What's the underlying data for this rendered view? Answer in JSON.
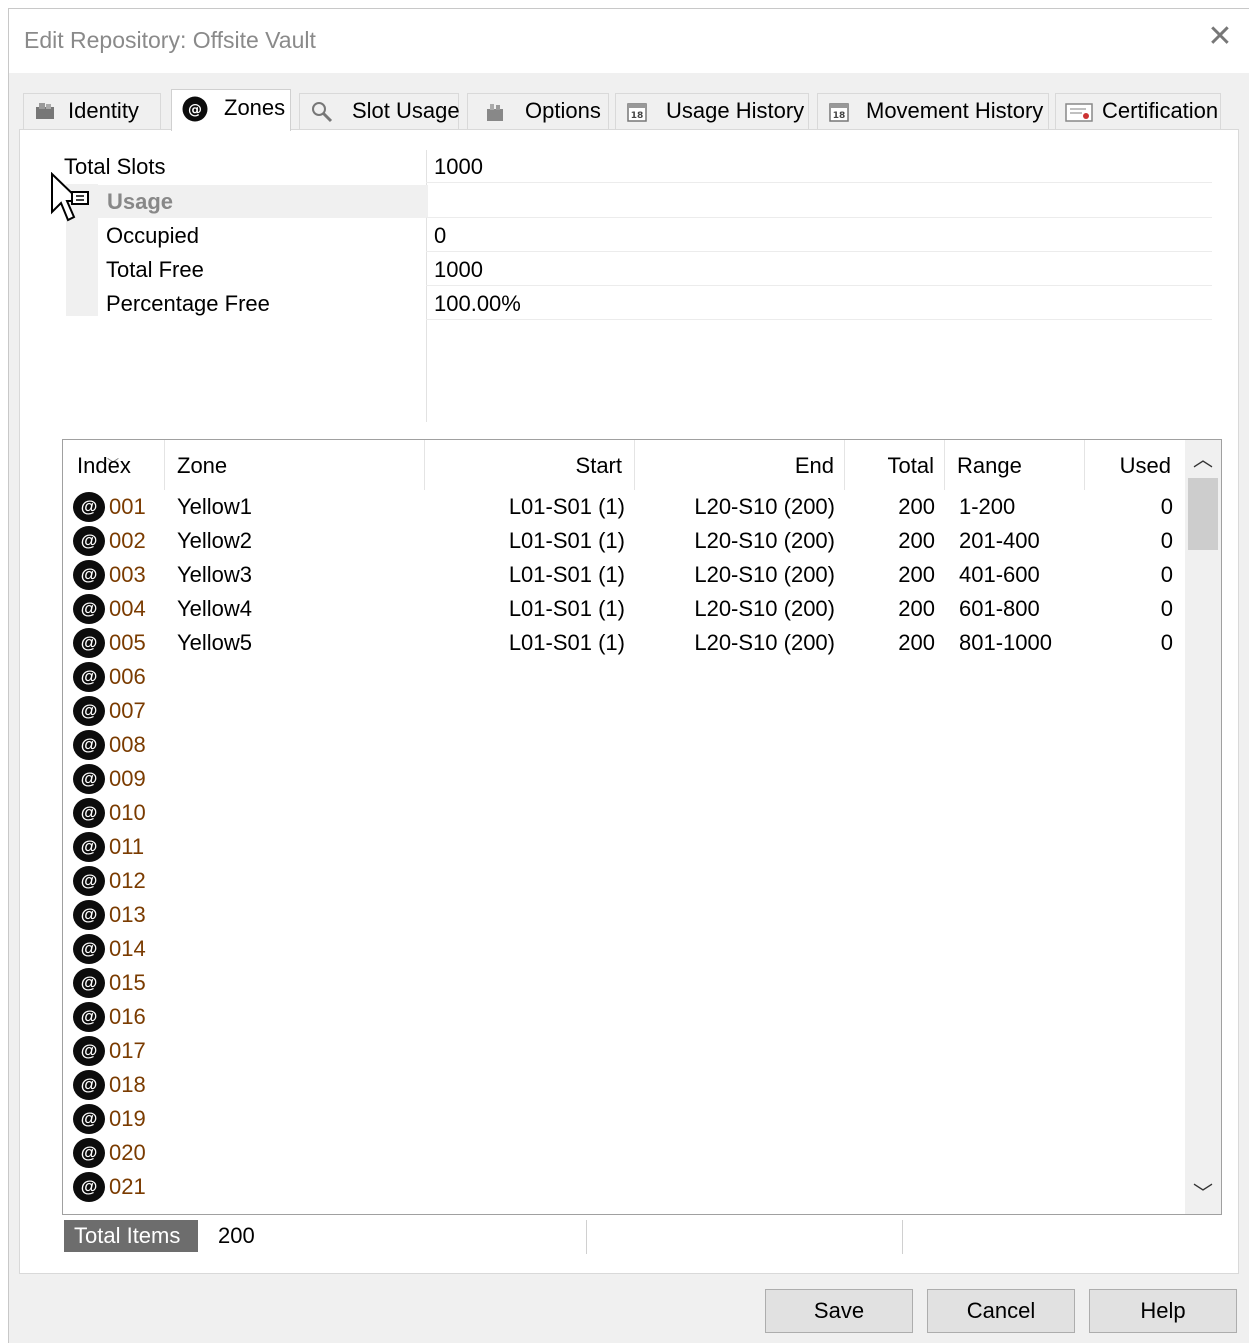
{
  "window": {
    "title": "Edit Repository: Offsite Vault"
  },
  "tabs": [
    {
      "label": "Identity",
      "icon": "identity-icon"
    },
    {
      "label": "Zones",
      "icon": "zones-icon"
    },
    {
      "label": "Slot Usage",
      "icon": "magnifier-icon"
    },
    {
      "label": "Options",
      "icon": "options-icon"
    },
    {
      "label": "Usage History",
      "icon": "calendar-icon"
    },
    {
      "label": "Movement History",
      "icon": "calendar-icon"
    },
    {
      "label": "Certification",
      "icon": "certificate-icon"
    }
  ],
  "active_tab": "Zones",
  "properties": {
    "total_slots": {
      "label": "Total Slots",
      "value": "1000"
    },
    "usage_header": "Usage",
    "occupied": {
      "label": "Occupied",
      "value": "0"
    },
    "total_free": {
      "label": "Total Free",
      "value": "1000"
    },
    "percentage_free": {
      "label": "Percentage Free",
      "value": "100.00%"
    }
  },
  "zones_table": {
    "columns": [
      "Index",
      "Zone",
      "Start",
      "End",
      "Total",
      "Range",
      "Used"
    ],
    "rows": [
      {
        "index": "001",
        "zone": "Yellow1",
        "start": "L01-S01 (1)",
        "end": "L20-S10 (200)",
        "total": "200",
        "range": "1-200",
        "used": "0"
      },
      {
        "index": "002",
        "zone": "Yellow2",
        "start": "L01-S01 (1)",
        "end": "L20-S10 (200)",
        "total": "200",
        "range": "201-400",
        "used": "0"
      },
      {
        "index": "003",
        "zone": "Yellow3",
        "start": "L01-S01 (1)",
        "end": "L20-S10 (200)",
        "total": "200",
        "range": "401-600",
        "used": "0"
      },
      {
        "index": "004",
        "zone": "Yellow4",
        "start": "L01-S01 (1)",
        "end": "L20-S10 (200)",
        "total": "200",
        "range": "601-800",
        "used": "0"
      },
      {
        "index": "005",
        "zone": "Yellow5",
        "start": "L01-S01 (1)",
        "end": "L20-S10 (200)",
        "total": "200",
        "range": "801-1000",
        "used": "0"
      },
      {
        "index": "006",
        "zone": "",
        "start": "",
        "end": "",
        "total": "",
        "range": "",
        "used": ""
      },
      {
        "index": "007",
        "zone": "",
        "start": "",
        "end": "",
        "total": "",
        "range": "",
        "used": ""
      },
      {
        "index": "008",
        "zone": "",
        "start": "",
        "end": "",
        "total": "",
        "range": "",
        "used": ""
      },
      {
        "index": "009",
        "zone": "",
        "start": "",
        "end": "",
        "total": "",
        "range": "",
        "used": ""
      },
      {
        "index": "010",
        "zone": "",
        "start": "",
        "end": "",
        "total": "",
        "range": "",
        "used": ""
      },
      {
        "index": "011",
        "zone": "",
        "start": "",
        "end": "",
        "total": "",
        "range": "",
        "used": ""
      },
      {
        "index": "012",
        "zone": "",
        "start": "",
        "end": "",
        "total": "",
        "range": "",
        "used": ""
      },
      {
        "index": "013",
        "zone": "",
        "start": "",
        "end": "",
        "total": "",
        "range": "",
        "used": ""
      },
      {
        "index": "014",
        "zone": "",
        "start": "",
        "end": "",
        "total": "",
        "range": "",
        "used": ""
      },
      {
        "index": "015",
        "zone": "",
        "start": "",
        "end": "",
        "total": "",
        "range": "",
        "used": ""
      },
      {
        "index": "016",
        "zone": "",
        "start": "",
        "end": "",
        "total": "",
        "range": "",
        "used": ""
      },
      {
        "index": "017",
        "zone": "",
        "start": "",
        "end": "",
        "total": "",
        "range": "",
        "used": ""
      },
      {
        "index": "018",
        "zone": "",
        "start": "",
        "end": "",
        "total": "",
        "range": "",
        "used": ""
      },
      {
        "index": "019",
        "zone": "",
        "start": "",
        "end": "",
        "total": "",
        "range": "",
        "used": ""
      },
      {
        "index": "020",
        "zone": "",
        "start": "",
        "end": "",
        "total": "",
        "range": "",
        "used": ""
      },
      {
        "index": "021",
        "zone": "",
        "start": "",
        "end": "",
        "total": "",
        "range": "",
        "used": ""
      }
    ]
  },
  "status": {
    "label": "Total Items",
    "value": "200"
  },
  "buttons": {
    "save": "Save",
    "cancel": "Cancel",
    "help": "Help"
  },
  "colors": {
    "index_text": "#7a3b00",
    "status_label_bg": "#6d6d6d"
  }
}
